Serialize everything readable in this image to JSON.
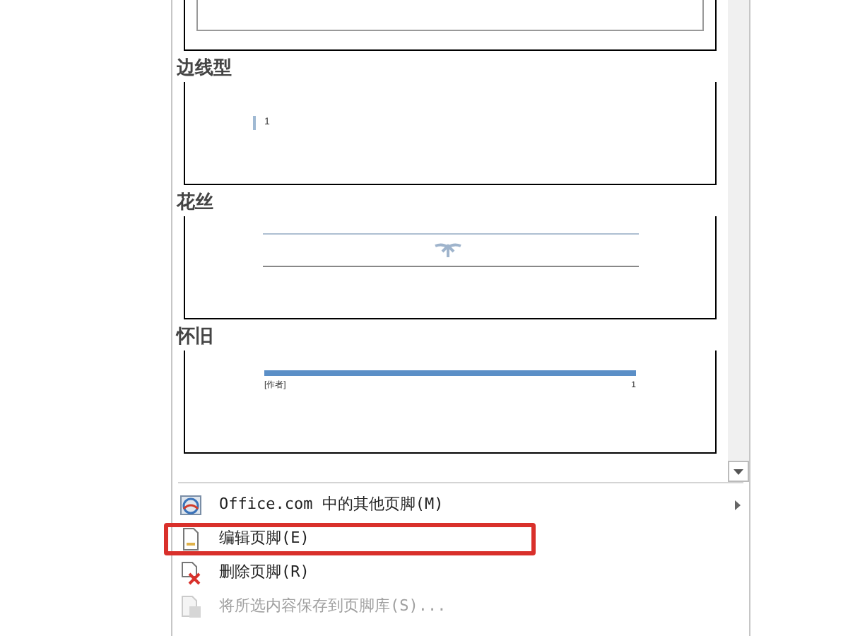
{
  "gallery": {
    "sections": [
      {
        "kind": "blank"
      },
      {
        "kind": "sideline",
        "title": "边线型",
        "page_number": "1"
      },
      {
        "kind": "filigree",
        "title": "花丝"
      },
      {
        "kind": "retro",
        "title": "怀旧",
        "author": "[作者]",
        "page_number": "1"
      }
    ]
  },
  "menu": [
    {
      "kind": "online",
      "label": "Office.com 中的其他页脚(M)",
      "submenu": true,
      "disabled": false,
      "highlighted": false
    },
    {
      "kind": "edit",
      "label": "编辑页脚(E)",
      "submenu": false,
      "disabled": false,
      "highlighted": true
    },
    {
      "kind": "remove",
      "label": "删除页脚(R)",
      "submenu": false,
      "disabled": false,
      "highlighted": false
    },
    {
      "kind": "save",
      "label": "将所选内容保存到页脚库(S)...",
      "submenu": false,
      "disabled": true,
      "highlighted": false
    }
  ]
}
